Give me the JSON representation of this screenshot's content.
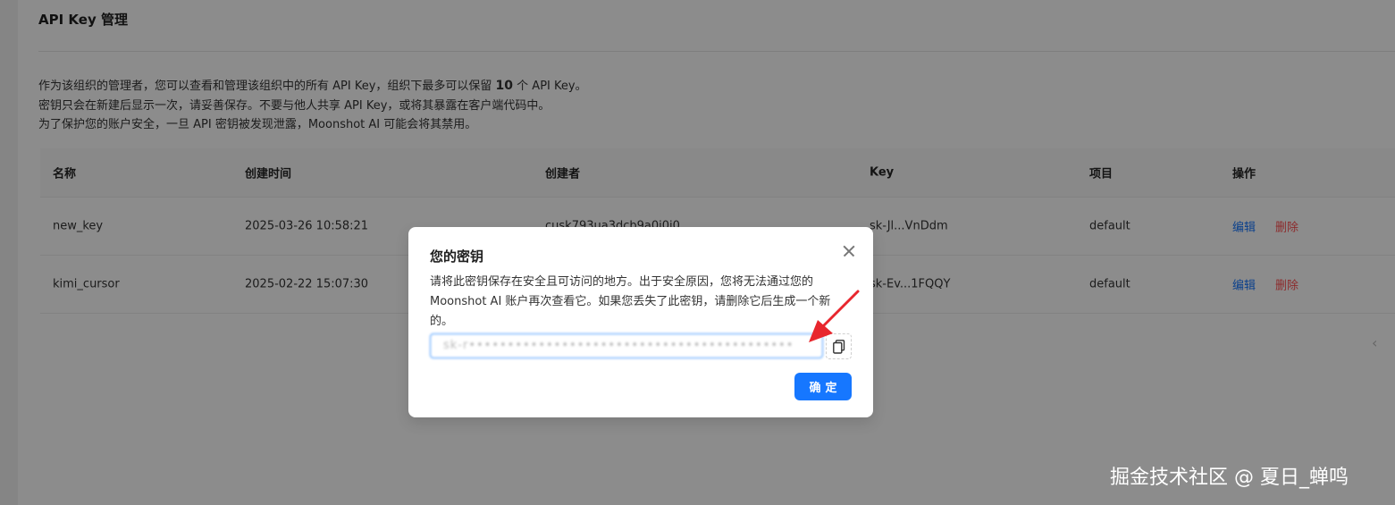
{
  "page": {
    "title": "API Key 管理",
    "desc_line1_pre": "作为该组织的管理者，您可以查看和管理该组织中的所有 API Key，组织下最多可以保留 ",
    "desc_line1_num": "10",
    "desc_line1_post": " 个 API Key。",
    "desc_line2": "密钥只会在新建后显示一次，请妥善保存。不要与他人共享 API Key，或将其暴露在客户端代码中。",
    "desc_line3": "为了保护您的账户安全，一旦 API 密钥被发现泄露，Moonshot AI 可能会将其禁用。"
  },
  "table": {
    "headers": [
      "名称",
      "创建时间",
      "创建者",
      "Key",
      "项目",
      "操作"
    ],
    "rows": [
      {
        "name": "new_key",
        "created": "2025-03-26 10:58:21",
        "creator": "cusk793ua3dcb9a0i0i0",
        "key": "sk-Jl...VnDdm",
        "project": "default"
      },
      {
        "name": "kimi_cursor",
        "created": "2025-02-22 15:07:30",
        "creator": "",
        "key": "sk-Ev...1FQQY",
        "project": "default"
      }
    ],
    "edit_label": "编辑",
    "delete_label": "删除"
  },
  "pagination": {
    "prev_glyph": "‹"
  },
  "modal": {
    "title": "您的密钥",
    "body": "请将此密钥保存在安全且可访问的地方。出于安全原因，您将无法通过您的 Moonshot AI 账户再次查看它。如果您丢失了此密钥，请删除它后生成一个新的。",
    "key_value": "sk-r••••••••••••••••••••••••••••••••••••••••••",
    "ok_label": "确定"
  },
  "watermark": "掘金技术社区 @ 夏日_蝉鸣",
  "colors": {
    "primary": "#1677ff",
    "danger": "#ff4d4f",
    "annotation": "#e8262d"
  }
}
